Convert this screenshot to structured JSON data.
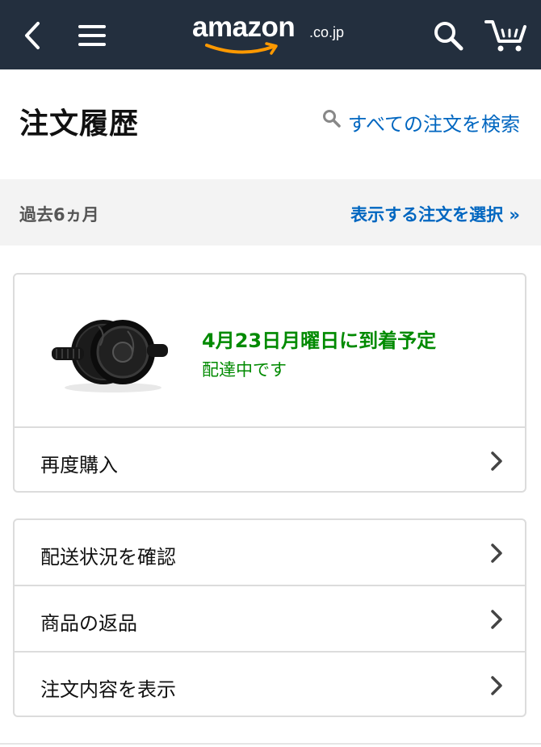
{
  "header": {
    "logo_word": "amazon",
    "logo_tld": ".co.jp",
    "icons": [
      "back-chevron-icon",
      "hamburger-menu-icon",
      "search-icon",
      "cart-icon"
    ],
    "bg_color": "#232f3e",
    "logo_accent": "#ff9900"
  },
  "page": {
    "title": "注文履歴",
    "search_link": "すべての注文を検索"
  },
  "filter": {
    "period": "過去6ヵ月",
    "select_link": "表示する注文を選択 »"
  },
  "order": {
    "eta": "4月23日月曜日に到着予定",
    "status": "配達中です",
    "status_color": "#008a00",
    "product_image": "ab-roller-wheel"
  },
  "actions_primary": [
    {
      "label": "再度購入"
    }
  ],
  "actions_secondary": [
    {
      "label": "配送状況を確認"
    },
    {
      "label": "商品の返品"
    },
    {
      "label": "注文内容を表示"
    }
  ],
  "link_color": "#0066c0"
}
